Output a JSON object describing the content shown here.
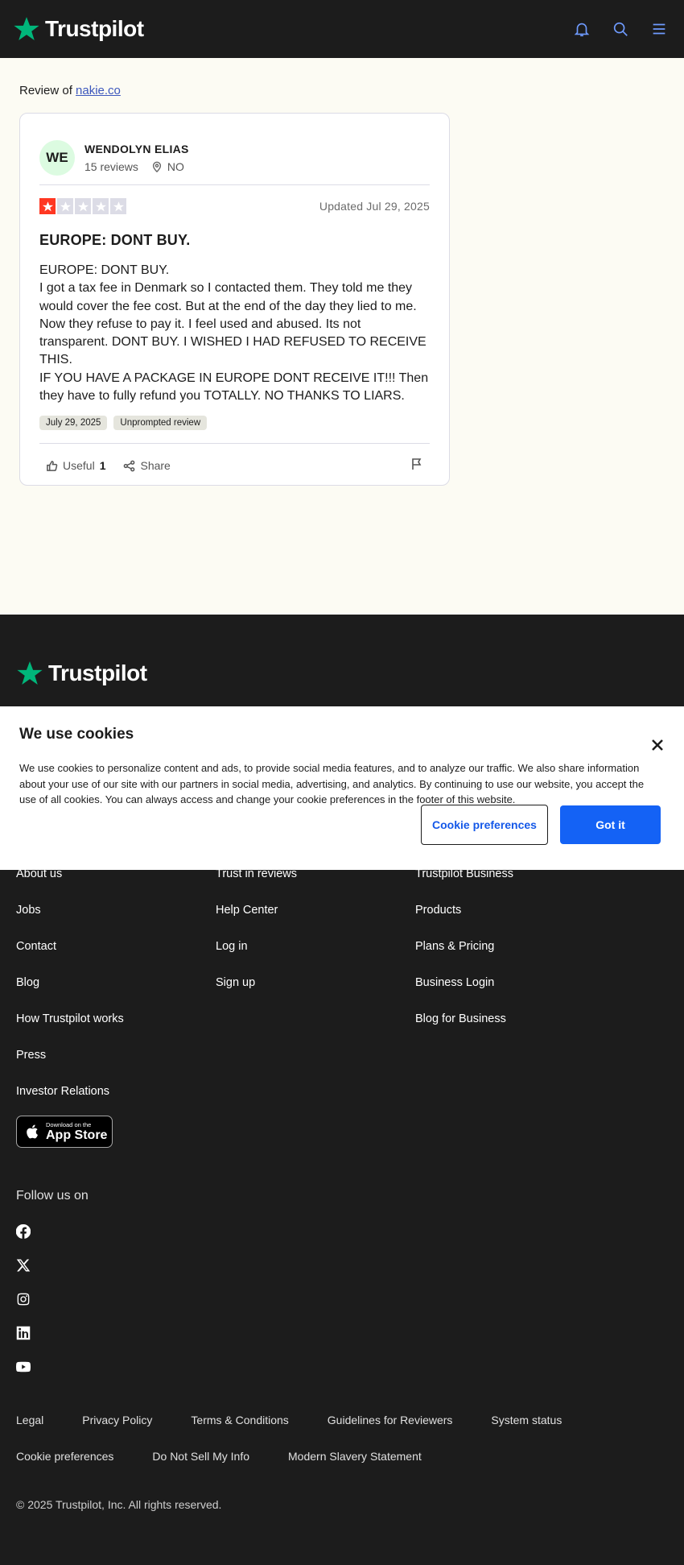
{
  "header": {
    "brand": "Trustpilot"
  },
  "review_of": {
    "prefix": "Review of",
    "company": "nakie.co"
  },
  "review": {
    "reviewer": {
      "initials": "WE",
      "name": "WENDOLYN ELIAS",
      "review_count": "15 reviews",
      "country": "NO"
    },
    "rating": 1,
    "rating_max": 5,
    "updated": "Updated Jul 29, 2025",
    "title": "EUROPE: DONT BUY.",
    "body": "EUROPE: DONT BUY.\nI got a tax fee in Denmark so I contacted them. They told me they would cover the fee cost. But at the end of the day they lied to me. Now they refuse to pay it. I feel used and abused. Its not transparent. DONT BUY. I WISHED I HAD REFUSED TO RECEIVE THIS.\nIF YOU HAVE A PACKAGE IN EUROPE DONT RECEIVE IT!!! Then they have to fully refund you TOTALLY. NO THANKS TO LIARS.",
    "tags": [
      "July 29, 2025",
      "Unprompted review"
    ],
    "useful_label": "Useful",
    "useful_count": "1",
    "share_label": "Share"
  },
  "cookie": {
    "title": "We use cookies",
    "text": "We use cookies to personalize content and ads, to provide social media features, and to analyze our traffic. We also share information about your use of our site with our partners in social media, advertising, and analytics. By continuing to use our website, you accept the use of all cookies. You can always access and change your cookie preferences in the footer of this website.",
    "preferences_button": "Cookie preferences",
    "accept_button": "Got it"
  },
  "footer": {
    "brand": "Trustpilot",
    "col1": [
      "About us",
      "Jobs",
      "Contact",
      "Blog",
      "How Trustpilot works",
      "Press",
      "Investor Relations"
    ],
    "col2": [
      "Trust in reviews",
      "Help Center",
      "Log in",
      "Sign up"
    ],
    "col3": [
      "Trustpilot Business",
      "Products",
      "Plans & Pricing",
      "Business Login",
      "Blog for Business"
    ],
    "appstore_small": "Download on the",
    "appstore_big": "App Store",
    "follow": "Follow us on",
    "social_icons": [
      "facebook-icon",
      "x-icon",
      "instagram-icon",
      "linkedin-icon",
      "youtube-icon"
    ],
    "legal": [
      "Legal",
      "Privacy Policy",
      "Terms & Conditions",
      "Guidelines for Reviewers",
      "System status",
      "Cookie preferences",
      "Do Not Sell My Info",
      "Modern Slavery Statement"
    ],
    "copyright": "© 2025 Trustpilot, Inc. All rights reserved."
  },
  "colors": {
    "brand_green": "#00b67a",
    "star_red": "#ff3722",
    "primary_blue": "#1462f5",
    "dark_bg": "#1c1c1c"
  }
}
